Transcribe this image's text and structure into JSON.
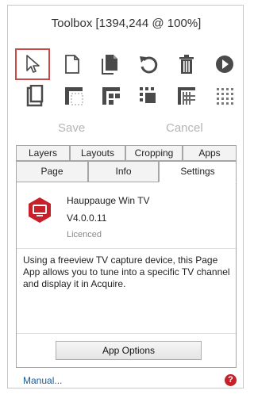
{
  "window": {
    "title": "Toolbox [1394,244 @ 100%]"
  },
  "tools_row1": [
    {
      "icon": "pointer-icon"
    },
    {
      "icon": "new-page-icon"
    },
    {
      "icon": "page-filled-icon"
    },
    {
      "icon": "undo-icon"
    },
    {
      "icon": "trash-icon"
    },
    {
      "icon": "play-icon"
    }
  ],
  "tools_row2": [
    {
      "icon": "crop-page-icon"
    },
    {
      "icon": "grid-corner-icon"
    },
    {
      "icon": "grid-split-icon"
    },
    {
      "icon": "grid-dashed-icon"
    },
    {
      "icon": "grid-lines-icon"
    },
    {
      "icon": "grid-dots-icon"
    }
  ],
  "actions": {
    "save_label": "Save",
    "cancel_label": "Cancel"
  },
  "tabs_row1": [
    "Layers",
    "Layouts",
    "Cropping",
    "Apps"
  ],
  "tabs_row2": [
    "Page",
    "Info",
    "Settings"
  ],
  "active_tab": "Settings",
  "app": {
    "name": "Hauppauge Win TV",
    "version": "V4.0.0.11",
    "license": "Licenced",
    "description": "Using a freeview TV capture device, this Page App allows you to tune into a specific TV channel and display it in Acquire.",
    "button_label": "App Options"
  },
  "footer": {
    "manual_label": "Manual...",
    "help_icon": "question-icon",
    "help_symbol": "?"
  },
  "colors": {
    "accent_red": "#c8202a",
    "selected_border": "#c94a4a",
    "icon_gray": "#4a4a4a",
    "link_blue": "#1a5a9a"
  }
}
